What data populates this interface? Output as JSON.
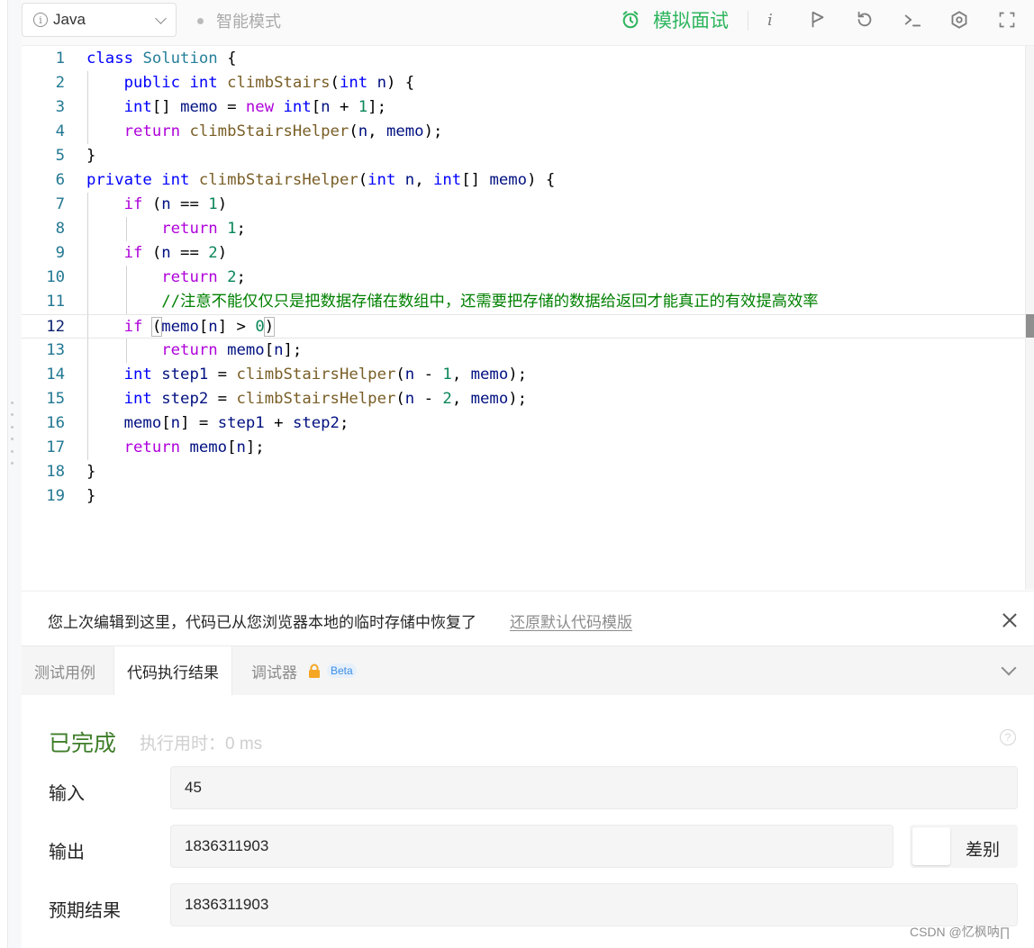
{
  "toolbar": {
    "language": "Java",
    "smart_mode": "智能模式",
    "mock_interview": "模拟面试",
    "info_glyph": "i"
  },
  "editor": {
    "lines": [
      {
        "n": "1",
        "text": "class Solution {"
      },
      {
        "n": "2",
        "text": "    public int climbStairs(int n) {"
      },
      {
        "n": "3",
        "text": "    int[] memo = new int[n + 1];"
      },
      {
        "n": "4",
        "text": "    return climbStairsHelper(n, memo);"
      },
      {
        "n": "5",
        "text": "}"
      },
      {
        "n": "6",
        "text": "private int climbStairsHelper(int n, int[] memo) {"
      },
      {
        "n": "7",
        "text": "    if (n == 1)"
      },
      {
        "n": "8",
        "text": "        return 1;"
      },
      {
        "n": "9",
        "text": "    if (n == 2)"
      },
      {
        "n": "10",
        "text": "        return 2;"
      },
      {
        "n": "11",
        "text": "        //注意不能仅仅只是把数据存储在数组中，还需要把存储的数据给返回才能真正的有效提高效率"
      },
      {
        "n": "12",
        "text": "    if (memo[n] > 0)"
      },
      {
        "n": "13",
        "text": "        return memo[n];"
      },
      {
        "n": "14",
        "text": "    int step1 = climbStairsHelper(n - 1, memo);"
      },
      {
        "n": "15",
        "text": "    int step2 = climbStairsHelper(n - 2, memo);"
      },
      {
        "n": "16",
        "text": "    memo[n] = step1 + step2;"
      },
      {
        "n": "17",
        "text": "    return memo[n];"
      },
      {
        "n": "18",
        "text": "}"
      },
      {
        "n": "19",
        "text": "}"
      }
    ]
  },
  "notice": {
    "text": "您上次编辑到这里，代码已从您浏览器本地的临时存储中恢复了",
    "link": "还原默认代码模版"
  },
  "tabs": {
    "testcase": "测试用例",
    "result": "代码执行结果",
    "debugger": "调试器",
    "beta": "Beta"
  },
  "result": {
    "status": "已完成",
    "exec_time": "执行用时：0 ms",
    "help_glyph": "?",
    "input_label": "输入",
    "input_value": "45",
    "output_label": "输出",
    "output_value": "1836311903",
    "diff_label": "差别",
    "expected_label": "预期结果",
    "expected_value": "1836311903"
  },
  "watermark": "CSDN @忆枫呐∏",
  "colors": {
    "accent_green": "#2db55d",
    "status_green": "#3f7e2a",
    "keyword_blue": "#0000ff",
    "comment_green": "#008000"
  }
}
